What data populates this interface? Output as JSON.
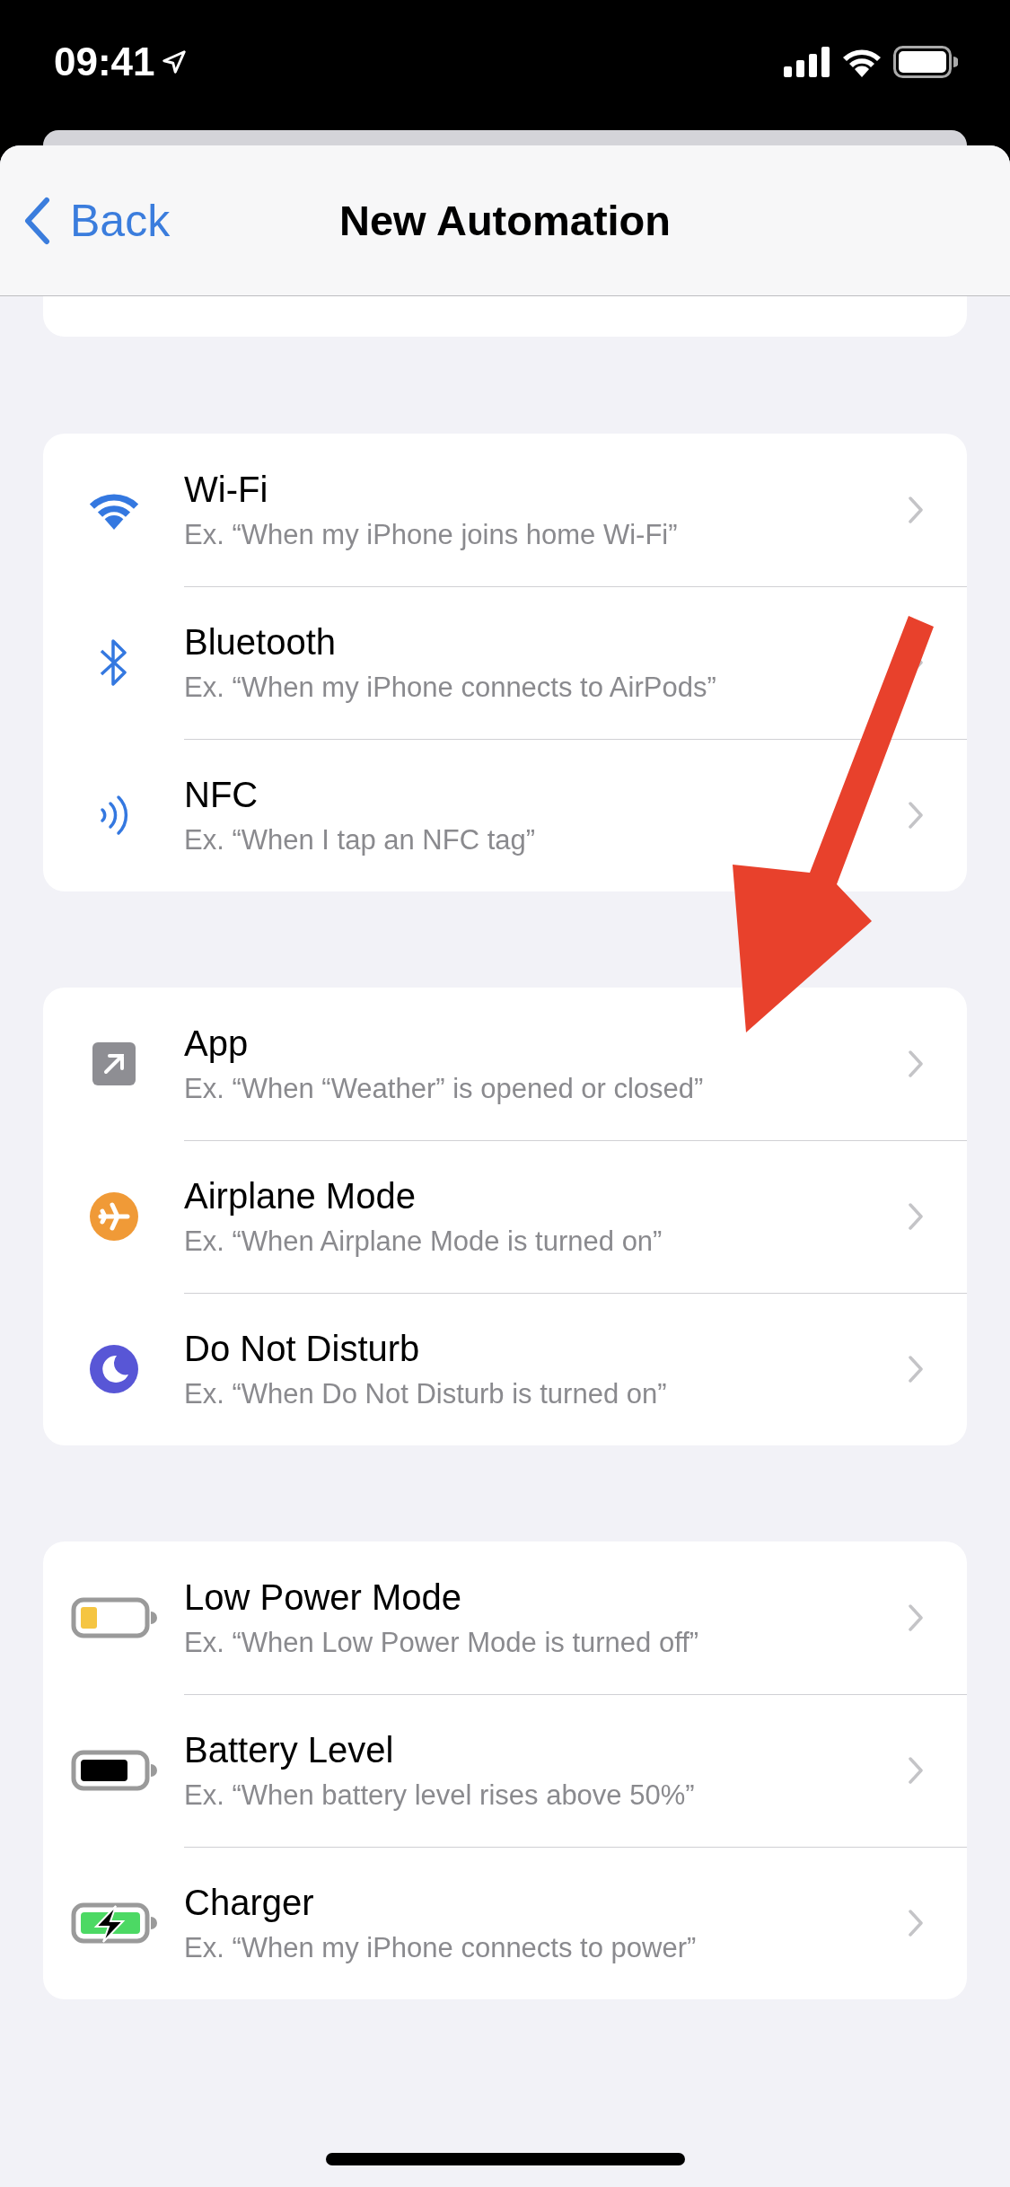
{
  "status_bar": {
    "time": "09:41"
  },
  "nav": {
    "back": "Back",
    "title": "New Automation"
  },
  "groups": [
    {
      "items": [
        {
          "kind": "wifi",
          "title": "Wi-Fi",
          "example": "Ex. “When my iPhone joins home Wi-Fi”"
        },
        {
          "kind": "bluetooth",
          "title": "Bluetooth",
          "example": "Ex. “When my iPhone connects to AirPods”"
        },
        {
          "kind": "nfc",
          "title": "NFC",
          "example": "Ex. “When I tap an NFC tag”"
        }
      ]
    },
    {
      "items": [
        {
          "kind": "app",
          "title": "App",
          "example": "Ex. “When “Weather” is opened or closed”"
        },
        {
          "kind": "airplane",
          "title": "Airplane Mode",
          "example": "Ex. “When Airplane Mode is turned on”"
        },
        {
          "kind": "moon",
          "title": "Do Not Disturb",
          "example": "Ex. “When Do Not Disturb is turned on”"
        }
      ]
    },
    {
      "items": [
        {
          "kind": "battery-low",
          "title": "Low Power Mode",
          "example": "Ex. “When Low Power Mode is turned off”"
        },
        {
          "kind": "battery",
          "title": "Battery Level",
          "example": "Ex. “When battery level rises above 50%”"
        },
        {
          "kind": "battery-charging",
          "title": "Charger",
          "example": "Ex. “When my iPhone connects to power”"
        }
      ]
    }
  ]
}
